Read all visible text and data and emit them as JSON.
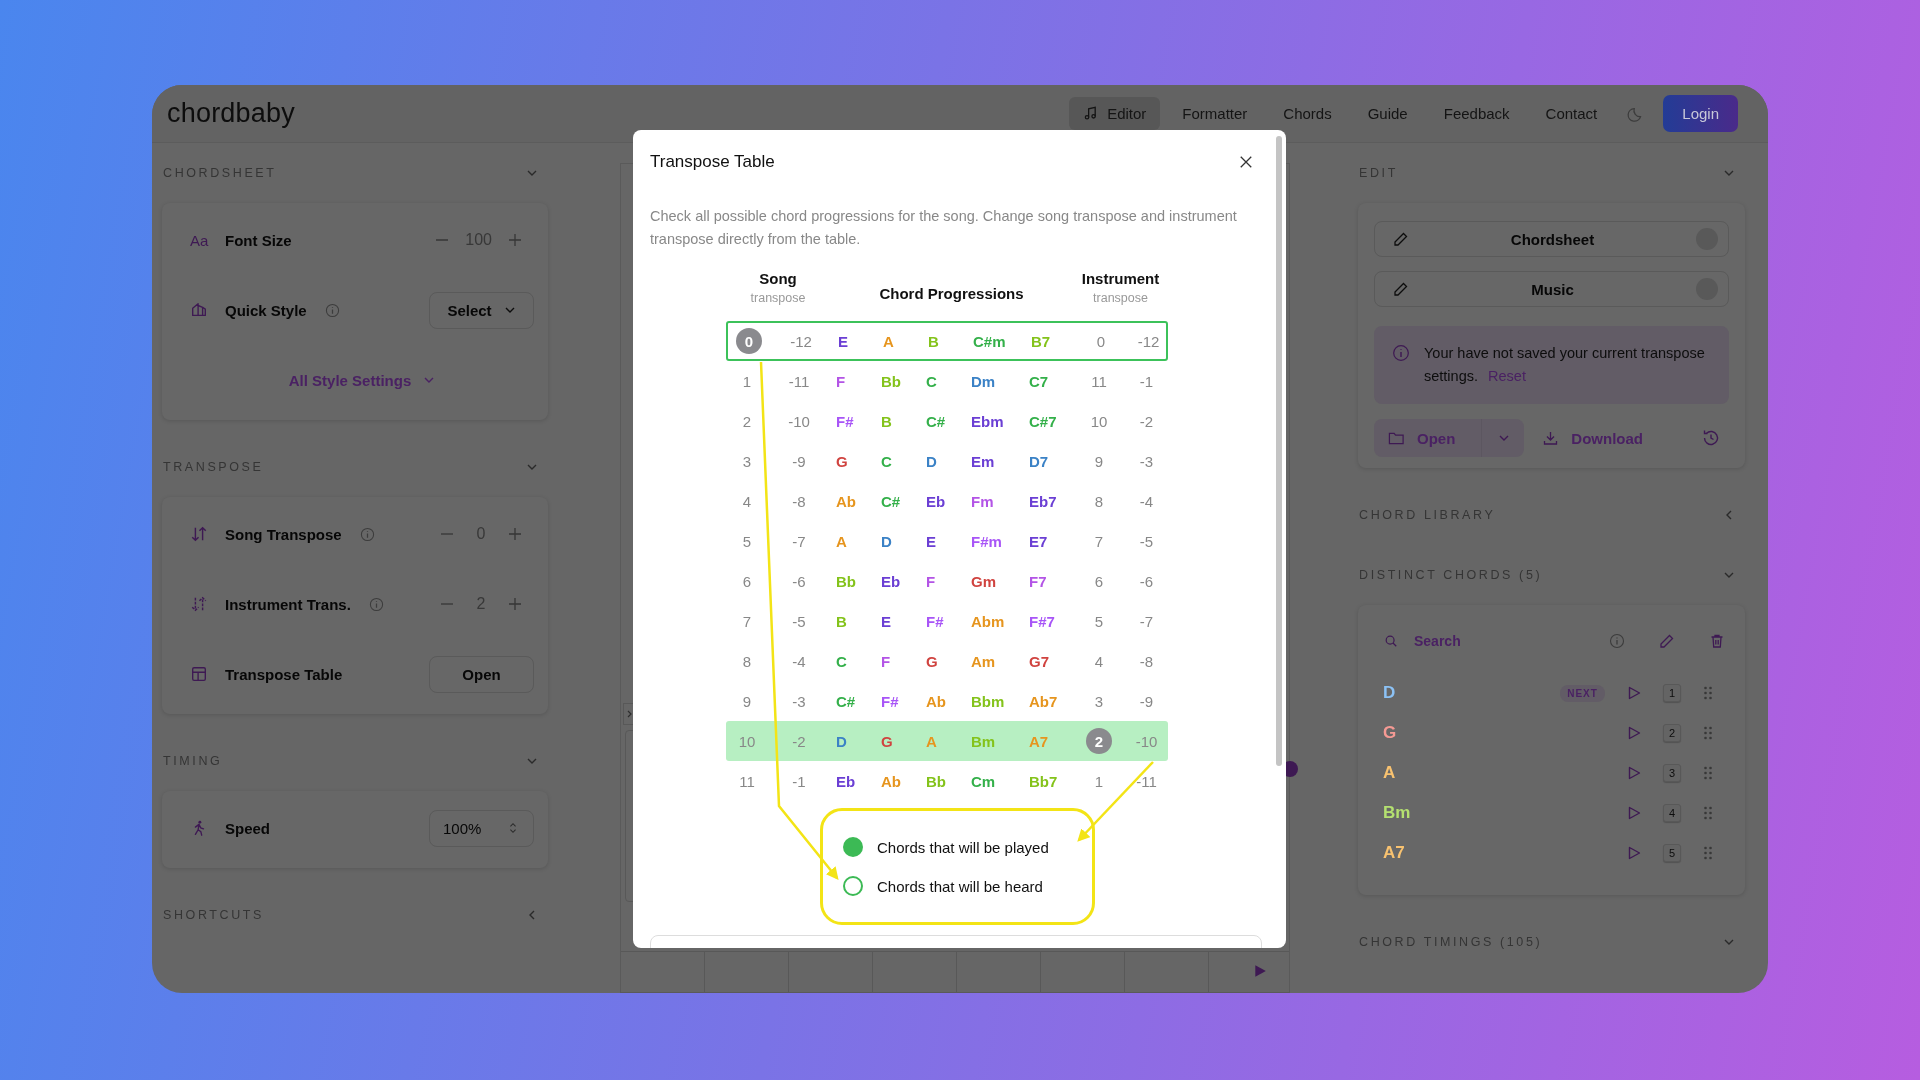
{
  "header": {
    "logo": "chordbaby",
    "nav": [
      {
        "label": "Editor",
        "selected": true
      },
      {
        "label": "Formatter",
        "selected": false
      },
      {
        "label": "Chords",
        "selected": false
      },
      {
        "label": "Guide",
        "selected": false
      },
      {
        "label": "Feedback",
        "selected": false
      },
      {
        "label": "Contact",
        "selected": false
      }
    ],
    "login": "Login"
  },
  "left_sections": [
    {
      "title": "CHORDSHEET",
      "expanded": true,
      "rows": [
        {
          "kind": "stepper",
          "glyph": "Aa",
          "label": "Font Size",
          "info": false,
          "value": "100"
        },
        {
          "kind": "select",
          "label": "Quick Style",
          "info": true,
          "control": "Select"
        },
        {
          "kind": "link",
          "label": "All Style Settings"
        }
      ]
    },
    {
      "title": "TRANSPOSE",
      "expanded": true,
      "rows": [
        {
          "kind": "stepper",
          "label": "Song Transpose",
          "info": true,
          "value": "0"
        },
        {
          "kind": "stepper",
          "label": "Instrument Trans.",
          "info": true,
          "value": "2"
        },
        {
          "kind": "button",
          "label": "Transpose Table",
          "info": false,
          "control": "Open"
        }
      ]
    },
    {
      "title": "TIMING",
      "expanded": true,
      "rows": [
        {
          "kind": "spinner",
          "label": "Speed",
          "info": false,
          "control": "100%"
        }
      ]
    },
    {
      "title": "SHORTCUTS",
      "expanded": false
    }
  ],
  "right": {
    "edit": {
      "title": "EDIT",
      "expanded": true,
      "buttons": [
        "Chordsheet",
        "Music"
      ],
      "notice": "Your have not saved your current transpose settings.",
      "notice_link": "Reset",
      "open": "Open",
      "download": "Download"
    },
    "library": {
      "title": "CHORD LIBRARY",
      "expanded": false
    },
    "distinct": {
      "title": "DISTINCT CHORDS (5)",
      "expanded": true,
      "search_placeholder": "Search",
      "chords": [
        {
          "name": "D",
          "color": "#8cc2f5",
          "badge": "NEXT",
          "key": "1"
        },
        {
          "name": "G",
          "color": "#f59a94",
          "key": "2"
        },
        {
          "name": "A",
          "color": "#f8c270",
          "key": "3"
        },
        {
          "name": "Bm",
          "color": "#b4e070",
          "key": "4"
        },
        {
          "name": "A7",
          "color": "#f8c270",
          "key": "5"
        }
      ]
    },
    "timings": {
      "title": "CHORD TIMINGS (105)",
      "expanded": true
    }
  },
  "modal": {
    "title": "Transpose Table",
    "description": "Check all possible chord progressions for the song. Change song transpose and instrument transpose directly from the table.",
    "headers": {
      "song": "Song",
      "song_sub": "transpose",
      "chords": "Chord Progressions",
      "instrument": "Instrument",
      "instrument_sub": "transpose"
    },
    "rows": [
      {
        "song": "0",
        "song_alt": "-12",
        "instrument": "0",
        "instrument_alt": "-12",
        "heard": true,
        "played": false,
        "song_selected": true,
        "instrument_selected": false,
        "chords": [
          {
            "name": "E",
            "color": "#6b3fd4"
          },
          {
            "name": "A",
            "color": "#e6951e"
          },
          {
            "name": "B",
            "color": "#84c31b"
          },
          {
            "name": "C#m",
            "color": "#34b04a"
          },
          {
            "name": "B7",
            "color": "#84c31b"
          }
        ]
      },
      {
        "song": "1",
        "song_alt": "-11",
        "instrument": "11",
        "instrument_alt": "-1",
        "heard": false,
        "played": false,
        "song_selected": false,
        "instrument_selected": false,
        "chords": [
          {
            "name": "F",
            "color": "#b354e6"
          },
          {
            "name": "Bb",
            "color": "#84c31b"
          },
          {
            "name": "C",
            "color": "#34b04a"
          },
          {
            "name": "Dm",
            "color": "#3b82c6"
          },
          {
            "name": "C7",
            "color": "#34b04a"
          }
        ]
      },
      {
        "song": "2",
        "song_alt": "-10",
        "instrument": "10",
        "instrument_alt": "-2",
        "heard": false,
        "played": false,
        "song_selected": false,
        "instrument_selected": false,
        "chords": [
          {
            "name": "F#",
            "color": "#a855f7"
          },
          {
            "name": "B",
            "color": "#84c31b"
          },
          {
            "name": "C#",
            "color": "#34b04a"
          },
          {
            "name": "Ebm",
            "color": "#6b3fd4"
          },
          {
            "name": "C#7",
            "color": "#34b04a"
          }
        ]
      },
      {
        "song": "3",
        "song_alt": "-9",
        "instrument": "9",
        "instrument_alt": "-3",
        "heard": false,
        "played": false,
        "song_selected": false,
        "instrument_selected": false,
        "chords": [
          {
            "name": "G",
            "color": "#d0433f"
          },
          {
            "name": "C",
            "color": "#34b04a"
          },
          {
            "name": "D",
            "color": "#3b82c6"
          },
          {
            "name": "Em",
            "color": "#6b3fd4"
          },
          {
            "name": "D7",
            "color": "#3b82c6"
          }
        ]
      },
      {
        "song": "4",
        "song_alt": "-8",
        "instrument": "8",
        "instrument_alt": "-4",
        "heard": false,
        "played": false,
        "song_selected": false,
        "instrument_selected": false,
        "chords": [
          {
            "name": "Ab",
            "color": "#e6951e"
          },
          {
            "name": "C#",
            "color": "#34b04a"
          },
          {
            "name": "Eb",
            "color": "#6b3fd4"
          },
          {
            "name": "Fm",
            "color": "#b354e6"
          },
          {
            "name": "Eb7",
            "color": "#6b3fd4"
          }
        ]
      },
      {
        "song": "5",
        "song_alt": "-7",
        "instrument": "7",
        "instrument_alt": "-5",
        "heard": false,
        "played": false,
        "song_selected": false,
        "instrument_selected": false,
        "chords": [
          {
            "name": "A",
            "color": "#e6951e"
          },
          {
            "name": "D",
            "color": "#3b82c6"
          },
          {
            "name": "E",
            "color": "#6b3fd4"
          },
          {
            "name": "F#m",
            "color": "#a855f7"
          },
          {
            "name": "E7",
            "color": "#6b3fd4"
          }
        ]
      },
      {
        "song": "6",
        "song_alt": "-6",
        "instrument": "6",
        "instrument_alt": "-6",
        "heard": false,
        "played": false,
        "song_selected": false,
        "instrument_selected": false,
        "chords": [
          {
            "name": "Bb",
            "color": "#84c31b"
          },
          {
            "name": "Eb",
            "color": "#6b3fd4"
          },
          {
            "name": "F",
            "color": "#b354e6"
          },
          {
            "name": "Gm",
            "color": "#d0433f"
          },
          {
            "name": "F7",
            "color": "#b354e6"
          }
        ]
      },
      {
        "song": "7",
        "song_alt": "-5",
        "instrument": "5",
        "instrument_alt": "-7",
        "heard": false,
        "played": false,
        "song_selected": false,
        "instrument_selected": false,
        "chords": [
          {
            "name": "B",
            "color": "#84c31b"
          },
          {
            "name": "E",
            "color": "#6b3fd4"
          },
          {
            "name": "F#",
            "color": "#a855f7"
          },
          {
            "name": "Abm",
            "color": "#e6951e"
          },
          {
            "name": "F#7",
            "color": "#a855f7"
          }
        ]
      },
      {
        "song": "8",
        "song_alt": "-4",
        "instrument": "4",
        "instrument_alt": "-8",
        "heard": false,
        "played": false,
        "song_selected": false,
        "instrument_selected": false,
        "chords": [
          {
            "name": "C",
            "color": "#34b04a"
          },
          {
            "name": "F",
            "color": "#b354e6"
          },
          {
            "name": "G",
            "color": "#d0433f"
          },
          {
            "name": "Am",
            "color": "#e6951e"
          },
          {
            "name": "G7",
            "color": "#d0433f"
          }
        ]
      },
      {
        "song": "9",
        "song_alt": "-3",
        "instrument": "3",
        "instrument_alt": "-9",
        "heard": false,
        "played": false,
        "song_selected": false,
        "instrument_selected": false,
        "chords": [
          {
            "name": "C#",
            "color": "#34b04a"
          },
          {
            "name": "F#",
            "color": "#a855f7"
          },
          {
            "name": "Ab",
            "color": "#e6951e"
          },
          {
            "name": "Bbm",
            "color": "#84c31b"
          },
          {
            "name": "Ab7",
            "color": "#e6951e"
          }
        ]
      },
      {
        "song": "10",
        "song_alt": "-2",
        "instrument": "2",
        "instrument_alt": "-10",
        "heard": false,
        "played": true,
        "song_selected": false,
        "instrument_selected": true,
        "chords": [
          {
            "name": "D",
            "color": "#3b82c6"
          },
          {
            "name": "G",
            "color": "#d0433f"
          },
          {
            "name": "A",
            "color": "#e6951e"
          },
          {
            "name": "Bm",
            "color": "#84c31b"
          },
          {
            "name": "A7",
            "color": "#e6951e"
          }
        ]
      },
      {
        "song": "11",
        "song_alt": "-1",
        "instrument": "1",
        "instrument_alt": "-11",
        "heard": false,
        "played": false,
        "song_selected": false,
        "instrument_selected": false,
        "chords": [
          {
            "name": "Eb",
            "color": "#6b3fd4"
          },
          {
            "name": "Ab",
            "color": "#e6951e"
          },
          {
            "name": "Bb",
            "color": "#84c31b"
          },
          {
            "name": "Cm",
            "color": "#34b04a"
          },
          {
            "name": "Bb7",
            "color": "#84c31b"
          }
        ]
      }
    ],
    "legend": [
      {
        "kind": "filled",
        "label": "Chords that will be played"
      },
      {
        "kind": "outline",
        "label": "Chords that will be heard"
      }
    ]
  }
}
